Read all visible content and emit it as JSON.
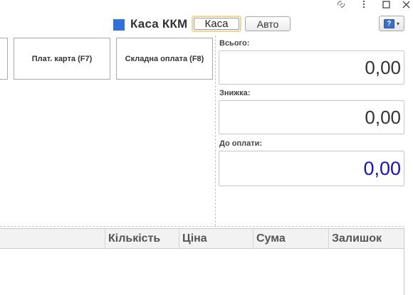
{
  "window": {
    "controls": [
      {
        "name": "link-icon",
        "glyph": "🔗"
      },
      {
        "name": "more-icon",
        "glyph": "⋮"
      },
      {
        "name": "maximize-icon",
        "glyph": "☐"
      },
      {
        "name": "close-icon",
        "glyph": "✕"
      }
    ]
  },
  "header": {
    "title": "Каса ККМ",
    "indicator_color": "#2f6fe0",
    "mode_buttons": {
      "kasa": "Каса",
      "auto": "Авто"
    },
    "help_button": {
      "glyph": "?",
      "dropdown": "▾"
    }
  },
  "function_keys": {
    "card": "Плат. карта (F7)",
    "mixed": "Складна оплата (F8)"
  },
  "totals": {
    "total_label": "Всього:",
    "total_value": "0,00",
    "discount_label": "Знижка:",
    "discount_value": "0,00",
    "due_label": "До оплати:",
    "due_value": "0,00",
    "due_color": "#1414c8"
  },
  "table": {
    "columns": [
      "Кількість",
      "Ціна",
      "Сума",
      "Залишок"
    ]
  }
}
